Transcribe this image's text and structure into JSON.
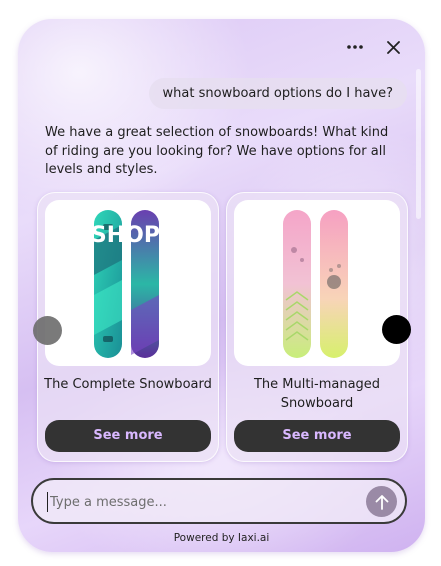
{
  "chat": {
    "user_message": "what snowboard options do I have?",
    "bot_message": "We have a great selection of snowboards!  What kind of riding are you looking for?  We have options for all levels and styles."
  },
  "products": [
    {
      "title": "The Complete Snowboard",
      "button_label": "See more",
      "image_icon": "snowboard-teal-purple",
      "board_text": "SHOPIFY"
    },
    {
      "title": "The Multi-managed Snowboard",
      "button_label": "See more",
      "image_icon": "snowboard-pink-green"
    }
  ],
  "composer": {
    "placeholder": "Type a message..."
  },
  "footer": {
    "powered_by": "Powered by Iaxi.ai"
  },
  "icons": {
    "menu": "more-icon",
    "close": "close-icon",
    "send": "arrow-up-icon",
    "prev": "carousel-prev",
    "next": "carousel-next"
  },
  "colors": {
    "button_bg": "#333333",
    "button_text": "#d9b8ff",
    "accent_background": "#dcc8f5"
  }
}
